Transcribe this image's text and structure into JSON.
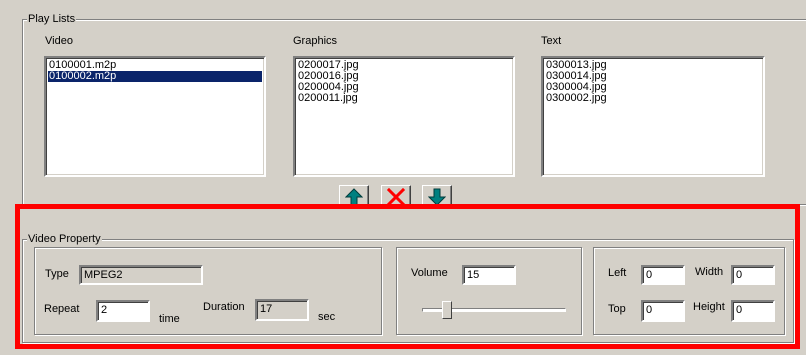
{
  "playlists": {
    "group_title": "Play Lists",
    "video": {
      "label": "Video",
      "items": [
        "0100001.m2p",
        "0100002.m2p"
      ],
      "selected_index": 1
    },
    "graphics": {
      "label": "Graphics",
      "items": [
        "0200017.jpg",
        "0200016.jpg",
        "0200004.jpg",
        "0200011.jpg"
      ]
    },
    "text": {
      "label": "Text",
      "items": [
        "0300013.jpg",
        "0300014.jpg",
        "0300004.jpg",
        "0300002.jpg"
      ]
    }
  },
  "toolbar": {
    "move_up": {
      "icon": "arrow-up-icon",
      "color": "#008080"
    },
    "delete": {
      "icon": "close-x-icon",
      "color": "#ff0000"
    },
    "move_down": {
      "icon": "arrow-down-icon",
      "color": "#008080"
    }
  },
  "video_property": {
    "group_title": "Video Property",
    "type_label": "Type",
    "type_value": "MPEG2",
    "repeat_label": "Repeat",
    "repeat_value": "2",
    "repeat_unit": "time",
    "duration_label": "Duration",
    "duration_value": "17",
    "duration_unit": "sec",
    "volume_label": "Volume",
    "volume_value": "15",
    "volume_slider_fraction": 0.15,
    "left_label": "Left",
    "left_value": "0",
    "width_label": "Width",
    "width_value": "0",
    "top_label": "Top",
    "top_value": "0",
    "height_label": "Height",
    "height_value": "0"
  },
  "highlight_color": "#ff0000"
}
